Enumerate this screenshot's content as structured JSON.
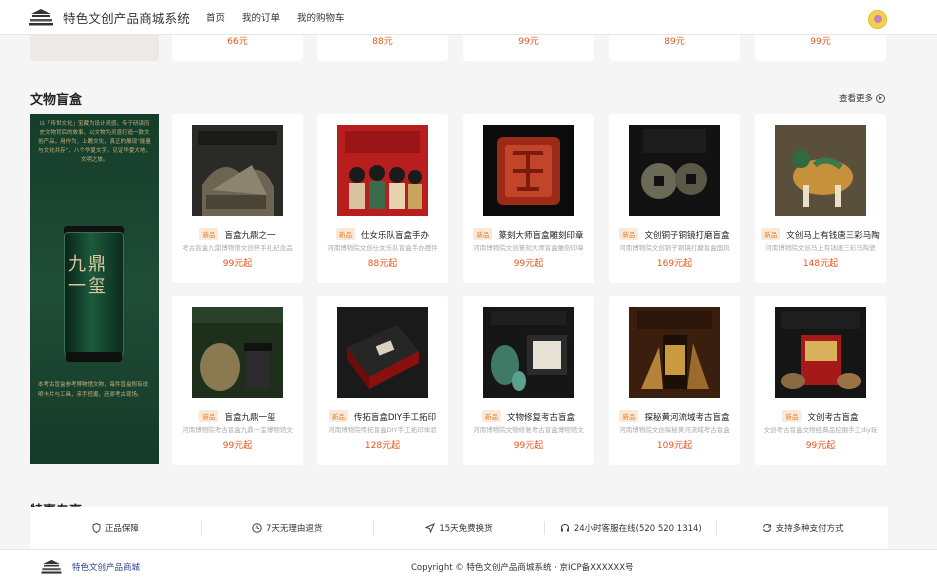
{
  "header": {
    "brand": "特色文创产品商城系统",
    "nav": [
      "首页",
      "我的订单",
      "我的购物车"
    ]
  },
  "prev_prices": [
    "66元",
    "88元",
    "99元",
    "89元",
    "99元"
  ],
  "section": {
    "title": "文物盲盒",
    "more": "查看更多"
  },
  "banner": {
    "top_text": "以「传世文化」宝藏为设计灵感，专于研读历史文物背后的故事，以文物为灵感打造一款文创产品，用作为，上瞻文化，真正的展现“能量与文化共存”，八个华夏文字，见证华夏大地，文明之旅。",
    "calligraphy": "九鼎一玺",
    "bottom_text": "本考古盲盒参考博物馆文物，每件盲盒附有说明卡片与工具，亲手挖掘，还原考古现场。"
  },
  "products": [
    {
      "tag": "新品",
      "name": "盲盒九鼎之一",
      "desc": "考古盲盒九鼎博物馆文创怀手礼纪念品",
      "price": "99元起"
    },
    {
      "tag": "新品",
      "name": "仕女乐队盲盒手办",
      "desc": "河南博物院文创仕女乐队盲盒手办摆件",
      "price": "88元起"
    },
    {
      "tag": "新品",
      "name": "篆刻大师盲盒雕刻印章",
      "desc": "河南博物院文创篆刻大师盲盒雕刻印章",
      "price": "99元起"
    },
    {
      "tag": "新品",
      "name": "文创铜子铜镜打磨盲盒",
      "desc": "河南博物院文创铜子铜镜打磨盲盒国风",
      "price": "169元起"
    },
    {
      "tag": "新品",
      "name": "文创马上有钱唐三彩马陶",
      "desc": "河南博物院文创马上有钱唐三彩马陶瓷",
      "price": "148元起"
    },
    {
      "tag": "新品",
      "name": "盲盒九鼎一玺",
      "desc": "河南博物院考古盲盒九鼎一玺博物馆文",
      "price": "99元起"
    },
    {
      "tag": "新品",
      "name": "传拓盲盒DIY手工拓印",
      "desc": "河南博物院传拓盲盒DIY手工拓印体验",
      "price": "128元起"
    },
    {
      "tag": "新品",
      "name": "文物修复考古盲盒",
      "desc": "河南博物院文物修复考古盲盒博物馆文",
      "price": "99元起"
    },
    {
      "tag": "新品",
      "name": "探秘黄河流域考古盲盒",
      "desc": "河南博物院文创探秘黄河流域考古盲盒",
      "price": "109元起"
    },
    {
      "tag": "新品",
      "name": "文创考古盲盒",
      "desc": "文创考古盲盒文物经典品挖掘手工diy玩",
      "price": "99元起"
    }
  ],
  "next_section_title": "特惠专享",
  "services": [
    {
      "icon": "shield-icon",
      "label": "正品保障"
    },
    {
      "icon": "clock-icon",
      "label": "7天无理由退货"
    },
    {
      "icon": "send-icon",
      "label": "15天免费换货"
    },
    {
      "icon": "headset-icon",
      "label": "24小时客服在线(520 520 1314)"
    },
    {
      "icon": "refresh-icon",
      "label": "支持多种支付方式"
    }
  ],
  "footer": {
    "brand": "特色文创产品商城",
    "copyright": "Copyright © 特色文创产品商城系统 · 京ICP备XXXXXX号"
  }
}
